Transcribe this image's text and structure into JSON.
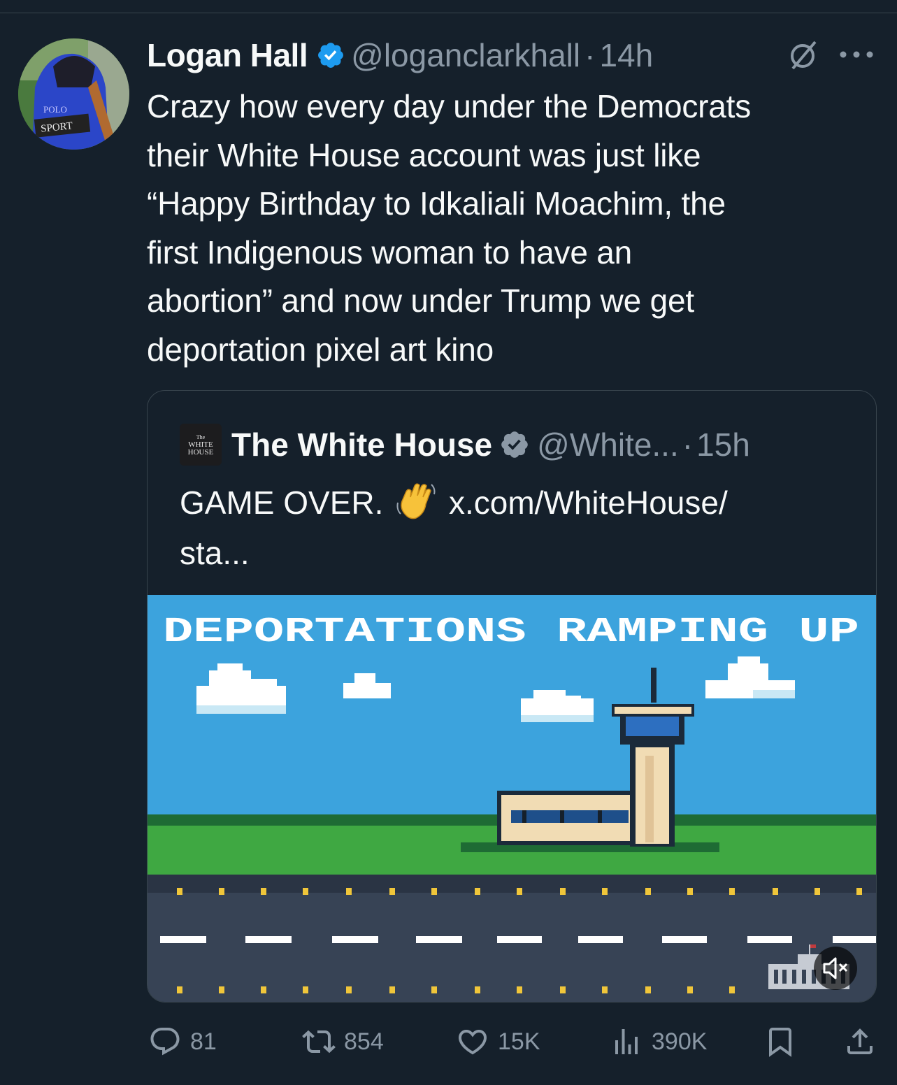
{
  "tweet": {
    "author_name": "Logan Hall",
    "handle": "@loganclarkhall",
    "separator": "·",
    "time": "14h",
    "text": "Crazy how every day under the Democrats\ntheir White House account was just like\n“Happy Birthday to Idkaliali Moachim, the\nfirst Indigenous woman to have an\nabortion” and now under Trump we get\ndeportation pixel art kino",
    "avatar_text": [
      "POLO",
      "SPORT"
    ]
  },
  "quote": {
    "author_name": "The White House",
    "handle": "@White...",
    "separator": "·",
    "time": "15h",
    "avatar_text": [
      "The",
      "WHITE",
      "HOUSE"
    ],
    "text_main": "GAME OVER.",
    "text_link": "x.com/WhiteHouse/",
    "text_cont": "sta...",
    "media_title": "DEPORTATIONS RAMPING UP"
  },
  "actions": {
    "replies": "81",
    "reposts": "854",
    "likes": "15K",
    "views": "390K"
  },
  "colors": {
    "background": "#15202b",
    "secondary_text": "#8b98a5",
    "verified": "#1d9bf0",
    "sky": "#3ca3dd",
    "grass": "#3fa842",
    "road": "#374355"
  }
}
